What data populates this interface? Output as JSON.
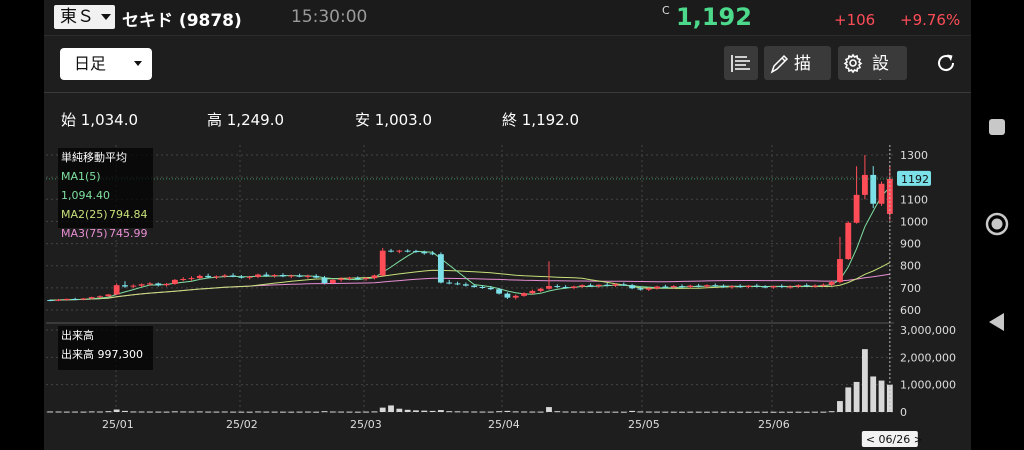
{
  "header": {
    "market": "東Ｓ",
    "stock_name": "セキド (9878)",
    "time": "15:30:00",
    "price_label": "C",
    "price": "1,192",
    "change": "+106",
    "change_pct": "+9.76%"
  },
  "toolbar": {
    "period": "日足",
    "draw_label": "描画",
    "settings_label": "設定"
  },
  "ohlc": {
    "open": "始 1,034.0",
    "high": "高 1,249.0",
    "low": "安 1,003.0",
    "close": "終 1,192.0"
  },
  "ma_legend": {
    "title": "単純移動平均",
    "rows": [
      {
        "name": "MA1(5)",
        "value": "1,094.40",
        "color": "#7fe0a0"
      },
      {
        "name": "MA2(25)",
        "value": "794.84",
        "color": "#c6e07a"
      },
      {
        "name": "MA3(75)",
        "value": "745.99",
        "color": "#e98fd4"
      }
    ]
  },
  "volume_legend": {
    "title": "出来高",
    "row": "出来高  997,300"
  },
  "colors": {
    "up": "#ff4d58",
    "down": "#7be0e8",
    "price": "#4cd98b",
    "grid": "#444444",
    "background": "#1e1e1e"
  },
  "chart_data": {
    "type": "candlestick",
    "price_axis": {
      "ticks": [
        "1300",
        "1200",
        "1100",
        "1000",
        "900",
        "800",
        "700",
        "600"
      ],
      "ylim": [
        600,
        1300
      ],
      "current_label": "1192"
    },
    "volume_axis": {
      "ticks": [
        "3,000,000",
        "2,000,000",
        "1,000,000",
        "0"
      ],
      "ylim": [
        0,
        3000000
      ]
    },
    "x_ticks": [
      "25/01",
      "25/02",
      "25/03",
      "25/04",
      "25/05",
      "25/06"
    ],
    "cursor_label": "< 06/26 >",
    "candles": [
      [
        645,
        648,
        640,
        644
      ],
      [
        644,
        650,
        640,
        646
      ],
      [
        646,
        652,
        642,
        650
      ],
      [
        650,
        655,
        645,
        648
      ],
      [
        648,
        654,
        644,
        652
      ],
      [
        652,
        660,
        648,
        658
      ],
      [
        658,
        666,
        654,
        662
      ],
      [
        662,
        672,
        660,
        670
      ],
      [
        670,
        720,
        668,
        712
      ],
      [
        712,
        730,
        700,
        706
      ],
      [
        706,
        716,
        698,
        710
      ],
      [
        710,
        720,
        704,
        716
      ],
      [
        716,
        726,
        710,
        720
      ],
      [
        720,
        724,
        706,
        712
      ],
      [
        712,
        722,
        706,
        718
      ],
      [
        718,
        740,
        714,
        736
      ],
      [
        736,
        748,
        730,
        740
      ],
      [
        740,
        752,
        732,
        744
      ],
      [
        744,
        760,
        738,
        754
      ],
      [
        754,
        764,
        744,
        748
      ],
      [
        748,
        756,
        740,
        752
      ],
      [
        752,
        762,
        746,
        756
      ],
      [
        756,
        766,
        748,
        750
      ],
      [
        750,
        758,
        742,
        746
      ],
      [
        746,
        754,
        738,
        750
      ],
      [
        750,
        764,
        744,
        760
      ],
      [
        760,
        770,
        750,
        754
      ],
      [
        754,
        762,
        746,
        758
      ],
      [
        758,
        766,
        748,
        752
      ],
      [
        752,
        760,
        744,
        756
      ],
      [
        756,
        764,
        748,
        750
      ],
      [
        750,
        760,
        742,
        754
      ],
      [
        754,
        762,
        744,
        746
      ],
      [
        746,
        754,
        716,
        722
      ],
      [
        722,
        740,
        716,
        736
      ],
      [
        736,
        748,
        728,
        742
      ],
      [
        742,
        750,
        734,
        746
      ],
      [
        746,
        752,
        738,
        740
      ],
      [
        740,
        748,
        732,
        744
      ],
      [
        744,
        760,
        738,
        756
      ],
      [
        756,
        880,
        754,
        868
      ],
      [
        868,
        876,
        860,
        864
      ],
      [
        864,
        872,
        856,
        868
      ],
      [
        868,
        874,
        860,
        866
      ],
      [
        866,
        872,
        858,
        862
      ],
      [
        862,
        868,
        850,
        856
      ],
      [
        856,
        866,
        848,
        852
      ],
      [
        852,
        860,
        720,
        724
      ],
      [
        724,
        736,
        716,
        720
      ],
      [
        720,
        728,
        712,
        716
      ],
      [
        716,
        724,
        706,
        710
      ],
      [
        710,
        718,
        700,
        704
      ],
      [
        704,
        712,
        696,
        700
      ],
      [
        700,
        708,
        690,
        694
      ],
      [
        694,
        700,
        670,
        674
      ],
      [
        674,
        680,
        650,
        656
      ],
      [
        656,
        670,
        648,
        664
      ],
      [
        664,
        680,
        660,
        676
      ],
      [
        676,
        692,
        670,
        686
      ],
      [
        686,
        700,
        680,
        696
      ],
      [
        696,
        820,
        692,
        708
      ],
      [
        708,
        716,
        700,
        704
      ],
      [
        704,
        712,
        696,
        700
      ],
      [
        700,
        710,
        694,
        706
      ],
      [
        706,
        716,
        700,
        712
      ],
      [
        712,
        720,
        704,
        708
      ],
      [
        708,
        716,
        700,
        714
      ],
      [
        714,
        722,
        706,
        710
      ],
      [
        710,
        720,
        704,
        716
      ],
      [
        716,
        724,
        708,
        712
      ],
      [
        712,
        718,
        694,
        698
      ],
      [
        698,
        706,
        688,
        692
      ],
      [
        692,
        702,
        686,
        698
      ],
      [
        698,
        710,
        692,
        706
      ],
      [
        706,
        714,
        698,
        702
      ],
      [
        702,
        712,
        696,
        708
      ],
      [
        708,
        716,
        700,
        704
      ],
      [
        704,
        714,
        698,
        710
      ],
      [
        710,
        718,
        702,
        706
      ],
      [
        706,
        716,
        700,
        712
      ],
      [
        712,
        720,
        704,
        708
      ],
      [
        708,
        716,
        700,
        704
      ],
      [
        704,
        712,
        696,
        708
      ],
      [
        708,
        716,
        700,
        704
      ],
      [
        704,
        712,
        698,
        710
      ],
      [
        710,
        718,
        702,
        706
      ],
      [
        706,
        712,
        698,
        702
      ],
      [
        702,
        710,
        696,
        708
      ],
      [
        708,
        716,
        700,
        704
      ],
      [
        704,
        712,
        696,
        706
      ],
      [
        706,
        716,
        700,
        712
      ],
      [
        712,
        720,
        704,
        708
      ],
      [
        708,
        716,
        700,
        710
      ],
      [
        710,
        720,
        704,
        714
      ],
      [
        714,
        730,
        708,
        726
      ],
      [
        726,
        930,
        720,
        830
      ],
      [
        830,
        1000,
        826,
        994
      ],
      [
        994,
        1249,
        990,
        1120
      ],
      [
        1120,
        1300,
        1100,
        1210
      ],
      [
        1210,
        1250,
        1060,
        1080
      ],
      [
        1080,
        1180,
        1070,
        1170
      ],
      [
        1034,
        1249,
        1003,
        1192
      ]
    ],
    "volumes": [
      20000,
      18000,
      15000,
      16000,
      14000,
      22000,
      18000,
      30000,
      90000,
      40000,
      20000,
      18000,
      16000,
      15000,
      14000,
      25000,
      20000,
      18000,
      22000,
      16000,
      15000,
      18000,
      14000,
      13000,
      12000,
      20000,
      15000,
      14000,
      13000,
      12000,
      14000,
      16000,
      12000,
      30000,
      18000,
      16000,
      14000,
      12000,
      15000,
      22000,
      160000,
      240000,
      120000,
      80000,
      60000,
      50000,
      40000,
      70000,
      30000,
      25000,
      20000,
      18000,
      16000,
      15000,
      30000,
      40000,
      22000,
      18000,
      16000,
      15000,
      180000,
      30000,
      18000,
      16000,
      14000,
      13000,
      12000,
      14000,
      12000,
      11000,
      40000,
      20000,
      16000,
      14000,
      12000,
      11000,
      10000,
      12000,
      11000,
      10000,
      12000,
      10000,
      11000,
      10000,
      9000,
      11000,
      10000,
      9000,
      10000,
      9000,
      10000,
      9000,
      11000,
      12000,
      30000,
      400000,
      900000,
      1100000,
      2300000,
      1300000,
      1150000,
      997300
    ]
  }
}
